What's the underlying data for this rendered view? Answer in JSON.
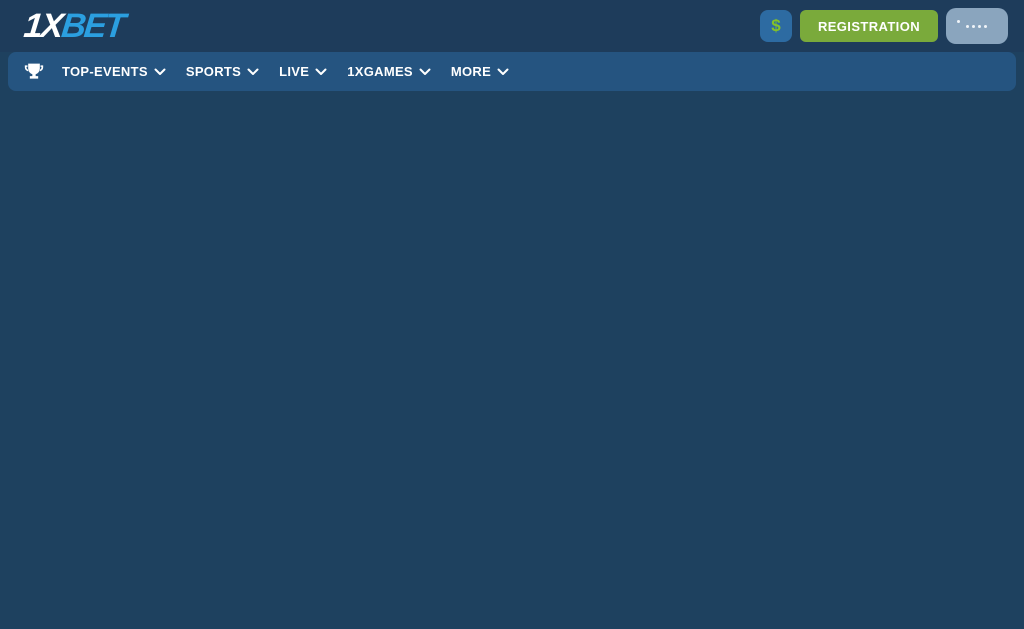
{
  "header": {
    "logo": {
      "part1": "1X",
      "part2": "BET"
    },
    "currency_button": {
      "symbol": "$",
      "icon": "dollar-icon"
    },
    "registration_button": {
      "label": "REGISTRATION"
    },
    "menu_button": {
      "icon": "dots-icon"
    }
  },
  "navbar": {
    "icon": "trophy-icon",
    "items": [
      {
        "label": "TOP-EVENTS",
        "icon": "chevron-down-icon"
      },
      {
        "label": "SPORTS",
        "icon": "chevron-down-icon"
      },
      {
        "label": "LIVE",
        "icon": "chevron-down-icon"
      },
      {
        "label": "1XGAMES",
        "icon": "chevron-down-icon"
      },
      {
        "label": "MORE",
        "icon": "chevron-down-icon"
      }
    ]
  },
  "colors": {
    "header_bg": "#1e3c5b",
    "body_bg": "#1e415f",
    "nav_bg": "#255480",
    "brand_blue": "#2b9fe0",
    "currency_button_bg": "#2d6ba2",
    "dollar_green": "#84c228",
    "registration_green": "#7aaa3b",
    "menu_button_bg": "#8aa5be",
    "text_white": "#ffffff"
  }
}
